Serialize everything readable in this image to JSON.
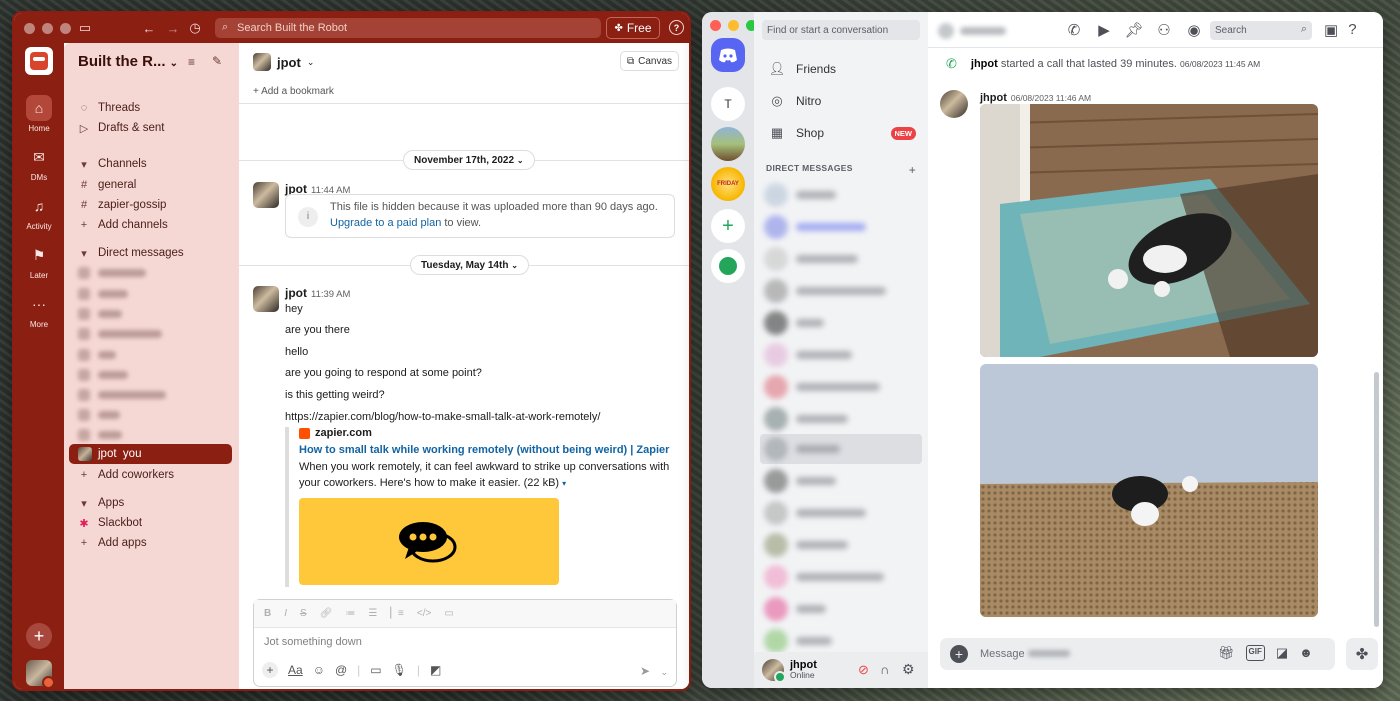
{
  "slack": {
    "search_placeholder": "Search Built the Robot",
    "plan_button": "Free",
    "help": "?",
    "rail": {
      "home": "Home",
      "dms": "DMs",
      "activity": "Activity",
      "later": "Later",
      "more": "More"
    },
    "workspace_name": "Built the R...",
    "sidebar": {
      "threads": "Threads",
      "drafts": "Drafts & sent",
      "channels_header": "Channels",
      "channels": [
        "general",
        "zapier-gossip"
      ],
      "add_channels": "Add channels",
      "dms_header": "Direct messages",
      "selected_dm": "jpot  you",
      "add_coworkers": "Add coworkers",
      "apps_header": "Apps",
      "slackbot": "Slackbot",
      "add_apps": "Add apps"
    },
    "channel": {
      "title": "jpot",
      "canvas_button": "Canvas",
      "add_bookmark": "Add a bookmark"
    },
    "dates": [
      "November 17th, 2022",
      "Tuesday, May 14th"
    ],
    "messages": [
      {
        "author": "jpot",
        "time": "11:44 AM",
        "hidden_text": "This file is hidden because it was uploaded more than 90 days ago.",
        "upgrade_link": "Upgrade to a paid plan",
        "upgrade_suffix": " to view."
      },
      {
        "author": "jpot",
        "time": "11:39 AM",
        "lines": [
          "hey",
          "are you there",
          "hello",
          "are you going to respond at some point?",
          "is this getting weird?"
        ],
        "url": "https://zapier.com/blog/how-to-make-small-talk-at-work-remotely/",
        "unfurl": {
          "site": "zapier.com",
          "title": "How to small talk while working remotely (without being weird) | Zapier",
          "description": "When you work remotely, it can feel awkward to strike up conversations with your coworkers. Here's how to make it easier. (22 kB)"
        }
      }
    ],
    "composer_placeholder": "Jot something down"
  },
  "discord": {
    "find_placeholder": "Find or start a conversation",
    "guild_text_server": "T",
    "nav": {
      "friends": "Friends",
      "nitro": "Nitro",
      "shop": "Shop",
      "shop_badge": "NEW"
    },
    "dm_header": "DIRECT MESSAGES",
    "user": {
      "name": "jhpot",
      "status": "Online"
    },
    "search_placeholder": "Search",
    "call_event": {
      "author": "jhpot",
      "text": "started a call that lasted 39 minutes.",
      "time": "06/08/2023 11:45 AM"
    },
    "message": {
      "author": "jhpot",
      "time": "06/08/2023 11:46 AM"
    },
    "composer_placeholder": "Message"
  },
  "colors": {
    "slack_aubergine": "#8a1f12",
    "slack_sidebar": "#f5d7d3",
    "discord_blurple": "#5865f2",
    "discord_green": "#23a55a",
    "link": "#1264a3"
  }
}
